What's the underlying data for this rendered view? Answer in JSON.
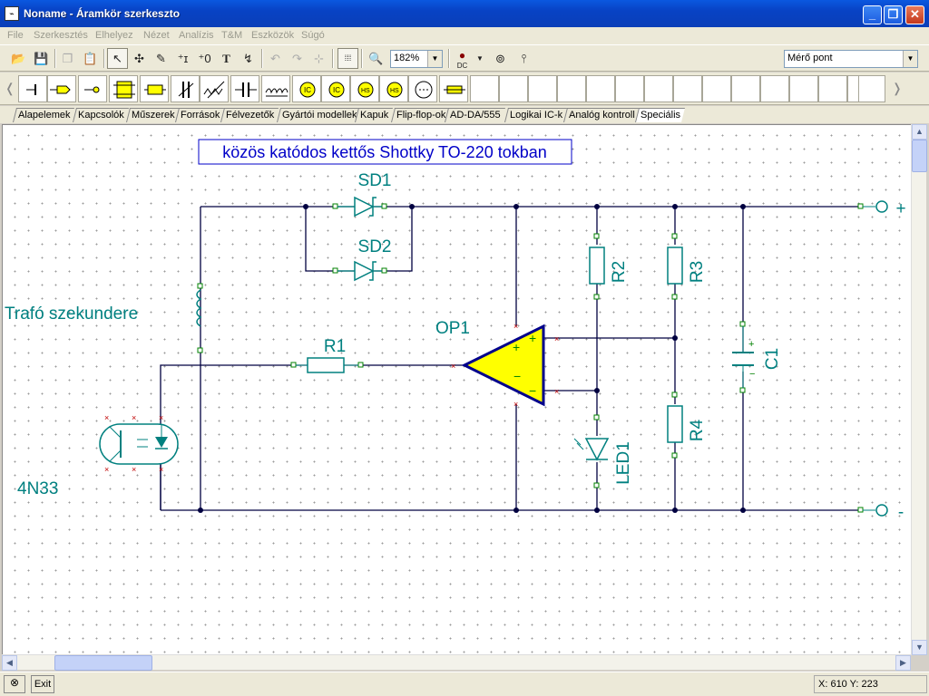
{
  "window": {
    "title": "Noname - Áramkör szerkeszto"
  },
  "menu": [
    "File",
    "Szerkesztés",
    "Elhelyez",
    "Nézet",
    "Analízis",
    "T&M",
    "Eszközök",
    "Súgó"
  ],
  "toolbar": {
    "zoom_value": "182%",
    "dc_label": "DC",
    "probe_select": "Mérő pont"
  },
  "tabs": [
    "Alapelemek",
    "Kapcsolók",
    "Műszerek",
    "Források",
    "Félvezetők",
    "Gyártói modellek",
    "Kapuk",
    "Flip-flop-ok",
    "AD-DA/555",
    "Logikai IC-k",
    "Analóg kontroll",
    "Speciális"
  ],
  "circuit": {
    "title": "közös katódos kettős Shottky TO-220 tokban",
    "labels": {
      "sd1": "SD1",
      "sd2": "SD2",
      "r1": "R1",
      "r2": "R2",
      "r3": "R3",
      "r4": "R4",
      "c1": "C1",
      "op1": "OP1",
      "led1": "LED1",
      "trafo": "Trafó szekundere",
      "opto": "4N33",
      "plus": "+",
      "minus": "-"
    }
  },
  "status": {
    "exit_label": "Exit",
    "coords": "X: 610 Y: 223"
  },
  "colors": {
    "wire": "#000040",
    "component": "#00807f",
    "label": "#008080",
    "opamp_fill": "#ffff00",
    "title_text": "#0000c8"
  }
}
